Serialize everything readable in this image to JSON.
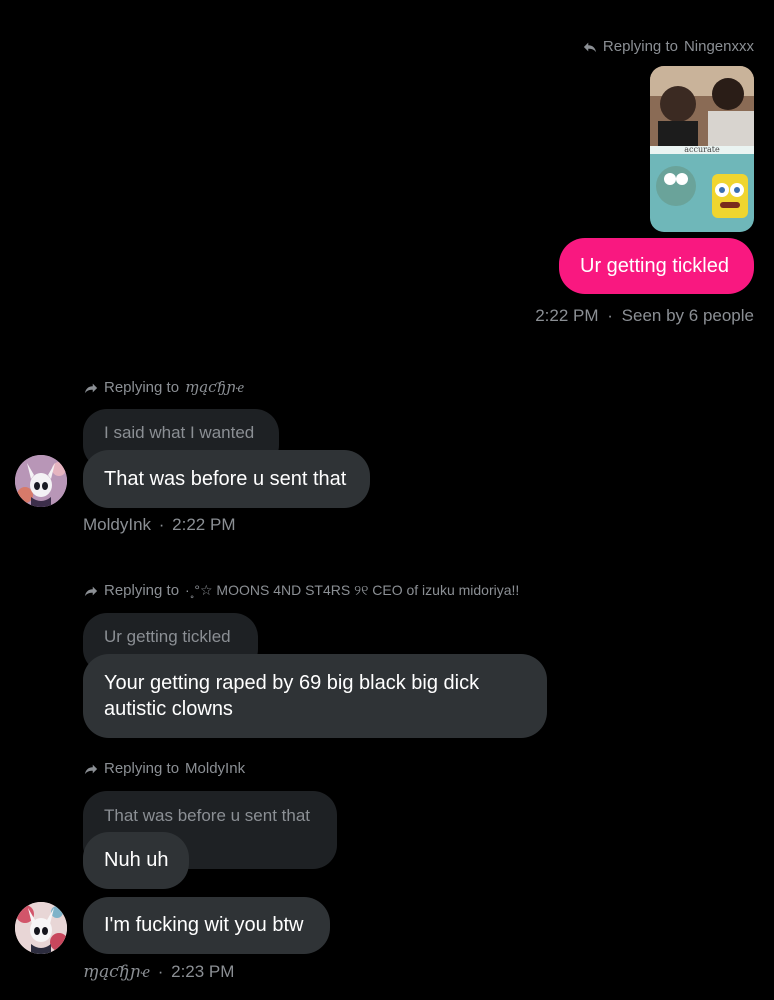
{
  "messages": {
    "own": {
      "reply_prefix": "Replying to",
      "reply_target": "Ningenxxx",
      "image_caption": "accurate",
      "text": "Ur getting tickled",
      "time": "2:22 PM",
      "separator": "·",
      "seen": "Seen by 6 people"
    },
    "m1": {
      "reply_prefix": "Replying to",
      "reply_target": "ɱąƈɧɲҽ",
      "quoted": "I said what I wanted",
      "text": "That was before u sent that",
      "author": "MoldyInk",
      "separator": "·",
      "time": "2:22 PM"
    },
    "m2": {
      "reply_prefix": "Replying to",
      "reply_target": "·˳°☆ MOONS 4ND ST4RS ୨୧ CEO of izuku midoriya!!",
      "quoted": "Ur getting tickled",
      "text_line1": "Your getting raped by 69 big black big dick",
      "text_line2": "autistic clowns"
    },
    "m3": {
      "reply_prefix": "Replying to",
      "reply_target": "MoldyInk",
      "quoted": "That was before u sent that",
      "text1": "Nuh uh",
      "text2": "I'm fucking wit you btw",
      "author": "ɱąƈɧɲҽ",
      "separator": "·",
      "time": "2:23 PM"
    }
  },
  "colors": {
    "background": "#000000",
    "own_bubble": "#f91880",
    "other_bubble": "#2f3336",
    "muted_text": "#8b8f94"
  },
  "icons": {
    "reply": "reply-arrow-icon",
    "forward": "share-arrow-icon"
  }
}
